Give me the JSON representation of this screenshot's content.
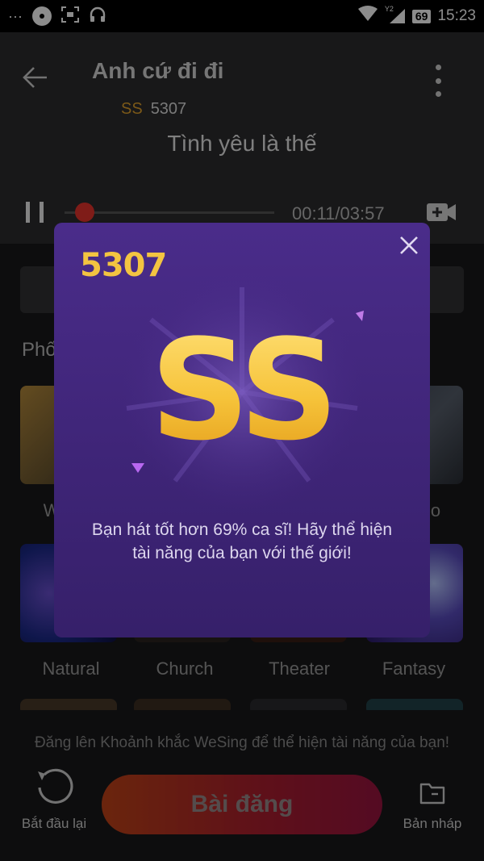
{
  "status_bar": {
    "left_glyph": "···",
    "right_badge": "Y2",
    "battery": "69",
    "time": "15:23",
    "icons": [
      "dots-icon",
      "cd-icon",
      "screenshot-icon",
      "headphones-icon",
      "wifi-icon",
      "signal-icon",
      "battery-icon"
    ]
  },
  "header": {
    "song_title": "Anh cứ đi đi",
    "grade": "SS",
    "score": "5307",
    "lyric": "Tình yêu là thế",
    "elapsed_time": "00:11/03:57",
    "progress_fraction": 0.05
  },
  "background": {
    "section_title": "Phố",
    "effects_row_1": [
      "W",
      "",
      "",
      "o"
    ],
    "effects_row_2": [
      "Natural",
      "Church",
      "Theater",
      "Fantasy"
    ]
  },
  "footer": {
    "promo_text": "Đăng lên Khoảnh khắc WeSing để thể hiện tài năng của bạn!",
    "restart_label": "Bắt đầu lại",
    "post_label": "Bài đăng",
    "drafts_label": "Bản nháp"
  },
  "modal": {
    "score": "5307",
    "grade": "SS",
    "message": "Bạn hát tốt hơn 69% ca sĩ! Hãy thể hiện tài năng của bạn với thế giới!"
  },
  "colors": {
    "accent_gold": "#f3c441",
    "modal_purple": "#4a2c8a",
    "progress_red": "#e8332c",
    "post_button": "#b5292a"
  }
}
